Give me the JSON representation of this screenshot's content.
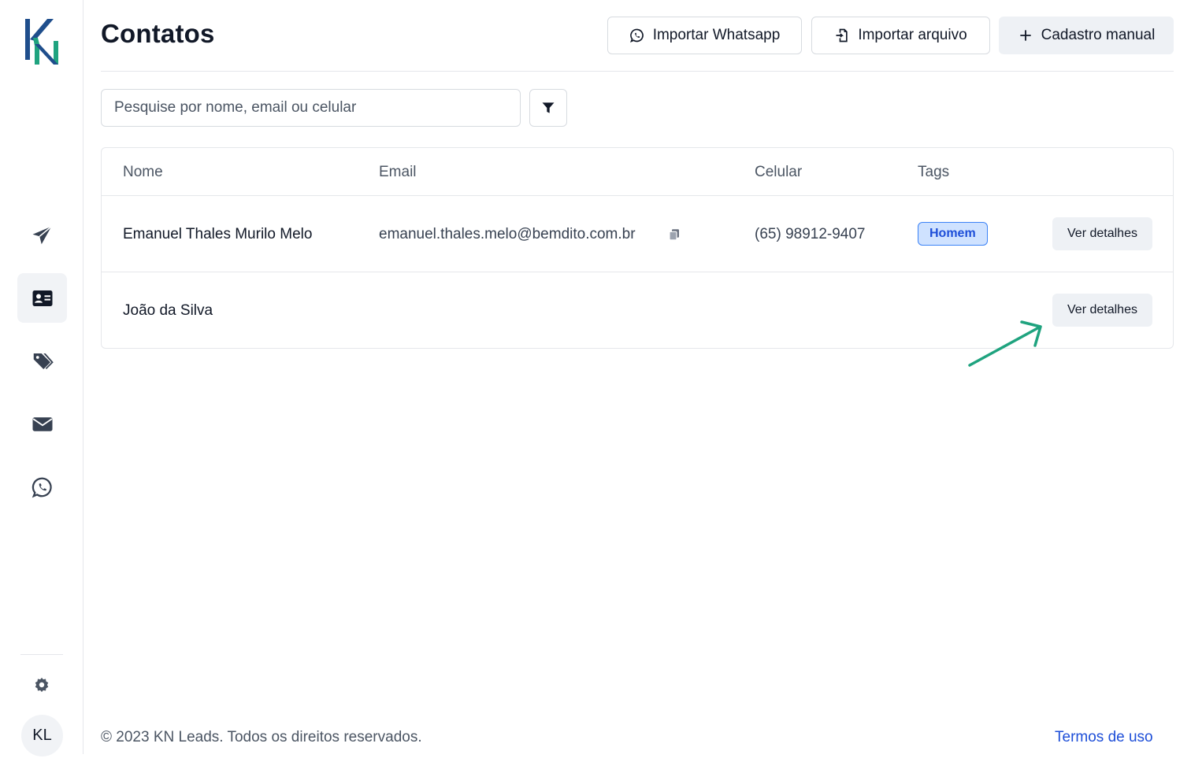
{
  "app": {
    "logo_text": "KN"
  },
  "sidebar": {
    "items": [
      {
        "name": "campaigns",
        "icon": "paper-plane-icon",
        "active": false
      },
      {
        "name": "contacts",
        "icon": "contact-card-icon",
        "active": true
      },
      {
        "name": "tags",
        "icon": "tags-icon",
        "active": false
      },
      {
        "name": "email",
        "icon": "envelope-icon",
        "active": false
      },
      {
        "name": "whatsapp",
        "icon": "whatsapp-icon",
        "active": false
      }
    ],
    "settings_icon": "gear-icon",
    "user_initials": "KL"
  },
  "header": {
    "title": "Contatos",
    "buttons": {
      "import_whatsapp": "Importar Whatsapp",
      "import_file": "Importar arquivo",
      "manual_add": "Cadastro manual"
    }
  },
  "search": {
    "placeholder": "Pesquise por nome, email ou celular",
    "value": ""
  },
  "table": {
    "columns": [
      "Nome",
      "Email",
      "Celular",
      "Tags"
    ],
    "rows": [
      {
        "name": "Emanuel Thales Murilo Melo",
        "email": "emanuel.thales.melo@bemdito.com.br",
        "phone": "(65) 98912-9407",
        "tag": "Homem",
        "action": "Ver detalhes"
      },
      {
        "name": "João da Silva",
        "email": "",
        "phone": "",
        "tag": "",
        "action": "Ver detalhes"
      }
    ]
  },
  "footer": {
    "copyright": "© 2023 KN Leads. Todos os direitos reservados.",
    "terms_link": "Termos de uso"
  },
  "colors": {
    "accent_green": "#1fa37f",
    "logo_blue": "#1f4e8c",
    "tag_bg": "#cfe2ff",
    "tag_border": "#3b82f6",
    "link_blue": "#1d4ed8"
  }
}
